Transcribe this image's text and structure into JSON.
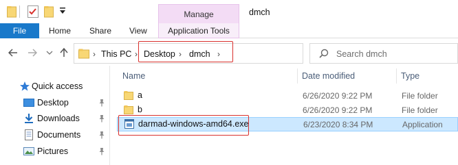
{
  "window": {
    "title": "dmch"
  },
  "contextual_tab": {
    "group_label": "Manage",
    "tab_label": "Application Tools"
  },
  "ribbon": {
    "tabs": [
      "File",
      "Home",
      "Share",
      "View"
    ]
  },
  "address_bar": {
    "crumbs": [
      "This PC",
      "Desktop",
      "dmch"
    ]
  },
  "search": {
    "placeholder": "Search dmch"
  },
  "nav_pane": {
    "items": [
      {
        "label": "Quick access",
        "icon": "star-icon",
        "pinned": false
      },
      {
        "label": "Desktop",
        "icon": "desktop-icon",
        "pinned": true
      },
      {
        "label": "Downloads",
        "icon": "download-icon",
        "pinned": true
      },
      {
        "label": "Documents",
        "icon": "documents-icon",
        "pinned": true
      },
      {
        "label": "Pictures",
        "icon": "pictures-icon",
        "pinned": true
      }
    ]
  },
  "file_list": {
    "columns": {
      "name": "Name",
      "date": "Date modified",
      "type": "Type"
    },
    "rows": [
      {
        "name": "a",
        "date": "6/26/2020 9:22 PM",
        "type": "File folder",
        "icon": "folder-icon"
      },
      {
        "name": "b",
        "date": "6/26/2020 9:22 PM",
        "type": "File folder",
        "icon": "folder-icon"
      },
      {
        "name": "darmad-windows-amd64.exe",
        "date": "6/23/2020 8:34 PM",
        "type": "Application",
        "icon": "application-icon"
      }
    ]
  },
  "colors": {
    "accent": "#1979ca",
    "manage": "#f3dcf5",
    "selection": "#cce8ff",
    "highlight": "#d9302c",
    "folder": "#f8d775"
  }
}
